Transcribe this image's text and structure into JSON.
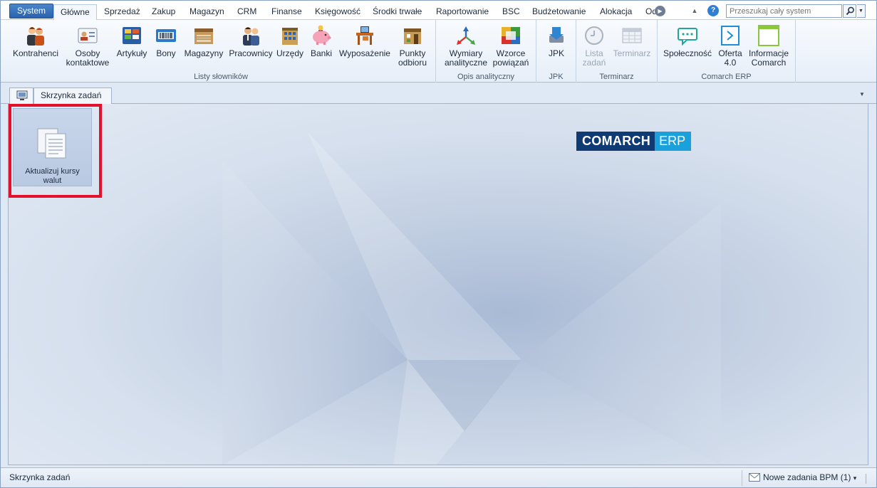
{
  "tabs": {
    "system": "System",
    "items": [
      "Główne",
      "Sprzedaż",
      "Zakup",
      "Magazyn",
      "CRM",
      "Finanse",
      "Księgowość",
      "Środki trwałe",
      "Raportowanie",
      "BSC",
      "Budżetowanie",
      "Alokacja",
      "Od"
    ],
    "active_index": 0
  },
  "search": {
    "placeholder": "Przeszukaj cały system"
  },
  "ribbon": {
    "groups": {
      "listy": "Listy słowników",
      "opis": "Opis analityczny",
      "jpk": "JPK",
      "terminarz": "Terminarz",
      "comarch": "Comarch ERP"
    },
    "buttons": {
      "kontrahenci": "Kontrahenci",
      "osoby_l1": "Osoby",
      "osoby_l2": "kontaktowe",
      "artykuly": "Artykuły",
      "bony": "Bony",
      "magazyny": "Magazyny",
      "pracownicy": "Pracownicy",
      "urzedy": "Urzędy",
      "banki": "Banki",
      "wyposazenie": "Wyposażenie",
      "punkty_l1": "Punkty",
      "punkty_l2": "odbioru",
      "wymiary_l1": "Wymiary",
      "wymiary_l2": "analityczne",
      "wzorce_l1": "Wzorce",
      "wzorce_l2": "powiązań",
      "jpk": "JPK",
      "lista_l1": "Lista",
      "lista_l2": "zadań",
      "terminarz": "Terminarz",
      "spolecznosc": "Społeczność",
      "oferta_l1": "Oferta",
      "oferta_l2": "4.0",
      "informacje_l1": "Informacje",
      "informacje_l2": "Comarch"
    }
  },
  "doc_tab": "Skrzynka zadań",
  "tile": {
    "line1": "Aktualizuj kursy",
    "line2": "walut"
  },
  "logo": {
    "part1": "COMARCH",
    "part2": "ERP"
  },
  "status": {
    "left": "Skrzynka zadań",
    "bpm": "Nowe zadania BPM (1)",
    "bpm_arrow": "▾"
  },
  "icons": {
    "up": "▲",
    "help": "?",
    "scroll": "▶",
    "drop": "▼",
    "doc_menu": "▼"
  },
  "colors": {
    "accent": "#2a62ad",
    "highlight": "#e4112d",
    "logo_dark": "#0f3a73",
    "logo_light": "#1aa1dc"
  }
}
